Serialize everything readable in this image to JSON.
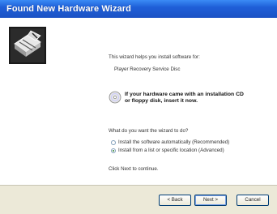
{
  "window": {
    "title": "Found New Hardware Wizard"
  },
  "intro": {
    "line": "This wizard helps you install software for:",
    "device": "Player Recovery Service Disc"
  },
  "cd_notice": {
    "line1": "If your hardware came with an installation CD",
    "line2": "or floppy disk, insert it now."
  },
  "question": "What do you want the wizard to do?",
  "options": [
    {
      "label": "Install the software automatically (Recommended)",
      "selected": false
    },
    {
      "label": "Install from a list or specific location (Advanced)",
      "selected": true
    }
  ],
  "continue_text": "Click Next to continue.",
  "buttons": {
    "back": "< Back",
    "next": "Next >",
    "cancel": "Cancel"
  },
  "colors": {
    "titlebar": "#1f5fd8",
    "background": "#ece9d8",
    "panel": "#ffffff"
  }
}
